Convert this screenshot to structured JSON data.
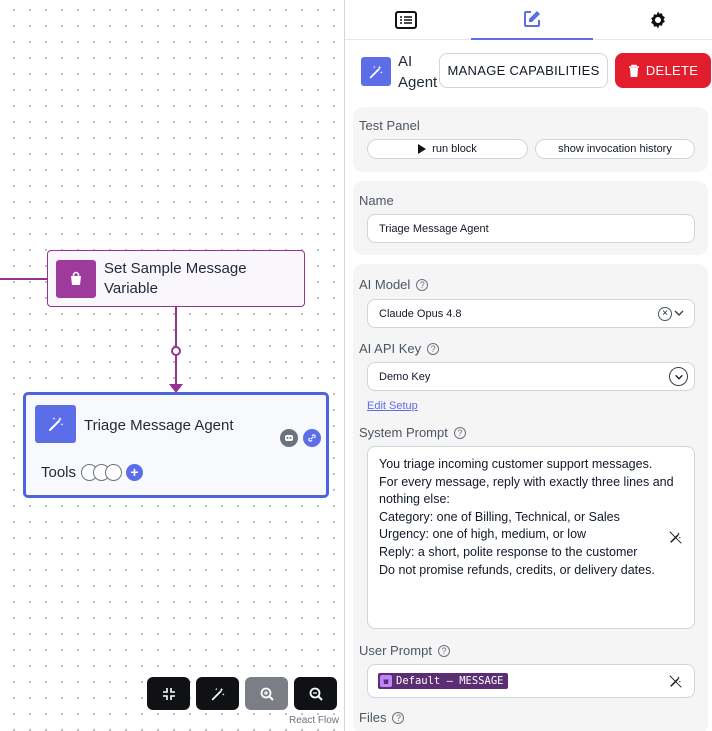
{
  "canvas": {
    "nodes": {
      "set_variable": {
        "label": "Set Sample Message Variable"
      },
      "agent": {
        "label": "Triage Message Agent",
        "tools_label": "Tools"
      }
    },
    "toolbar": {
      "icons": [
        "compress-icon",
        "magic-wand-icon",
        "zoom-in-icon",
        "zoom-out-icon"
      ]
    },
    "attribution": "React Flow"
  },
  "panel": {
    "tabs": [
      {
        "icon": "list-icon",
        "active": false
      },
      {
        "icon": "edit-icon",
        "active": true
      },
      {
        "icon": "gear-icon",
        "active": false
      }
    ],
    "header": {
      "title": "AI Agent",
      "manage_label": "MANAGE CAPABILITIES",
      "delete_label": "DELETE"
    },
    "test_panel": {
      "label": "Test Panel",
      "run_label": "run block",
      "history_label": "show invocation history"
    },
    "name": {
      "label": "Name",
      "value": "Triage Message Agent"
    },
    "ai_model": {
      "label": "AI Model",
      "value": "Claude Opus 4.8"
    },
    "api_key": {
      "label": "AI API Key",
      "value": "Demo Key",
      "edit_link": "Edit Setup"
    },
    "system_prompt": {
      "label": "System Prompt",
      "value": "You triage incoming customer support messages.\nFor every message, reply with exactly three lines and nothing else:\nCategory: one of Billing, Technical, or Sales\nUrgency: one of high, medium, or low\nReply: a short, polite response to the customer\nDo not promise refunds, credits, or delivery dates."
    },
    "user_prompt": {
      "label": "User Prompt",
      "tag": "Default – MESSAGE"
    },
    "files": {
      "label": "Files"
    }
  },
  "colors": {
    "accent": "#5b6ee8",
    "node_purple": "#93358f",
    "delete_red": "#e11d2e",
    "tag_bg": "#5b2d73"
  }
}
